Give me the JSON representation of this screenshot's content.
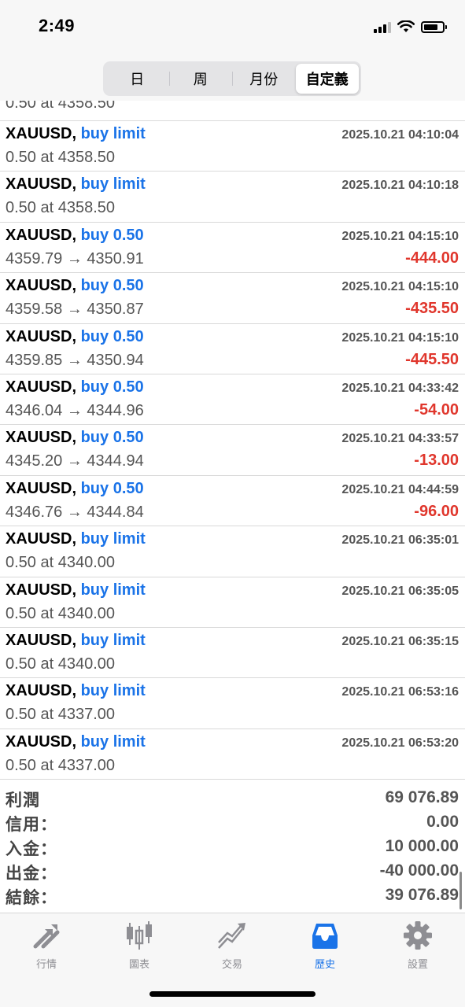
{
  "status_bar": {
    "time": "2:49"
  },
  "period_tabs": [
    {
      "label": "日",
      "active": false
    },
    {
      "label": "周",
      "active": false
    },
    {
      "label": "月份",
      "active": false
    },
    {
      "label": "自定義",
      "active": true
    }
  ],
  "partial_row": {
    "detail": "0.50 at 4358.50"
  },
  "orders": [
    {
      "symbol": "XAUUSD,",
      "type": "buy limit",
      "time": "2025.10.21 04:10:04",
      "detail": "0.50 at 4358.50",
      "profit": ""
    },
    {
      "symbol": "XAUUSD,",
      "type": "buy limit",
      "time": "2025.10.21 04:10:18",
      "detail": "0.50 at 4358.50",
      "profit": ""
    },
    {
      "symbol": "XAUUSD,",
      "type": "buy 0.50",
      "time": "2025.10.21 04:15:10",
      "detail": "4359.79 → 4350.91",
      "profit": "-444.00"
    },
    {
      "symbol": "XAUUSD,",
      "type": "buy 0.50",
      "time": "2025.10.21 04:15:10",
      "detail": "4359.58 → 4350.87",
      "profit": "-435.50"
    },
    {
      "symbol": "XAUUSD,",
      "type": "buy 0.50",
      "time": "2025.10.21 04:15:10",
      "detail": "4359.85 → 4350.94",
      "profit": "-445.50"
    },
    {
      "symbol": "XAUUSD,",
      "type": "buy 0.50",
      "time": "2025.10.21 04:33:42",
      "detail": "4346.04 → 4344.96",
      "profit": "-54.00"
    },
    {
      "symbol": "XAUUSD,",
      "type": "buy 0.50",
      "time": "2025.10.21 04:33:57",
      "detail": "4345.20 → 4344.94",
      "profit": "-13.00"
    },
    {
      "symbol": "XAUUSD,",
      "type": "buy 0.50",
      "time": "2025.10.21 04:44:59",
      "detail": "4346.76 → 4344.84",
      "profit": "-96.00"
    },
    {
      "symbol": "XAUUSD,",
      "type": "buy limit",
      "time": "2025.10.21 06:35:01",
      "detail": "0.50 at 4340.00",
      "profit": ""
    },
    {
      "symbol": "XAUUSD,",
      "type": "buy limit",
      "time": "2025.10.21 06:35:05",
      "detail": "0.50 at 4340.00",
      "profit": ""
    },
    {
      "symbol": "XAUUSD,",
      "type": "buy limit",
      "time": "2025.10.21 06:35:15",
      "detail": "0.50 at 4340.00",
      "profit": ""
    },
    {
      "symbol": "XAUUSD,",
      "type": "buy limit",
      "time": "2025.10.21 06:53:16",
      "detail": "0.50 at 4337.00",
      "profit": ""
    },
    {
      "symbol": "XAUUSD,",
      "type": "buy limit",
      "time": "2025.10.21 06:53:20",
      "detail": "0.50 at 4337.00",
      "profit": ""
    }
  ],
  "summary": [
    {
      "label": "利潤",
      "value": "69 076.89"
    },
    {
      "label": "信用：",
      "value": "0.00"
    },
    {
      "label": "入金：",
      "value": "10 000.00"
    },
    {
      "label": "出金：",
      "value": "-40 000.00"
    },
    {
      "label": "結餘：",
      "value": "39 076.89"
    }
  ],
  "tabbar": [
    {
      "label": "行情",
      "icon": "quotes-arrows-icon",
      "active": false
    },
    {
      "label": "圖表",
      "icon": "candlestick-chart-icon",
      "active": false
    },
    {
      "label": "交易",
      "icon": "trade-trend-icon",
      "active": false
    },
    {
      "label": "歷史",
      "icon": "history-inbox-icon",
      "active": true
    },
    {
      "label": "設置",
      "icon": "gear-icon",
      "active": false
    }
  ],
  "colors": {
    "accent": "#1a73e8",
    "loss": "#e0362c",
    "secondary_text": "#555555"
  }
}
